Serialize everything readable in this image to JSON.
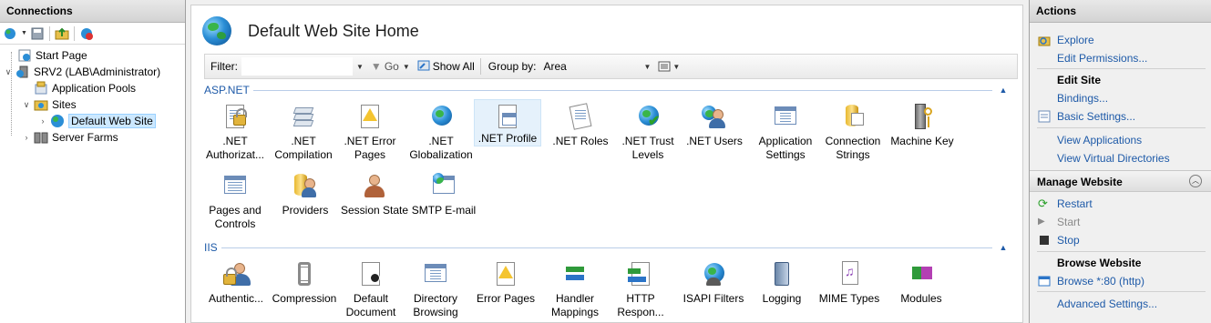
{
  "connections": {
    "title": "Connections",
    "tree": [
      {
        "label": "Start Page"
      },
      {
        "label": "SRV2 (LAB\\Administrator)"
      },
      {
        "label": "Application Pools"
      },
      {
        "label": "Sites"
      },
      {
        "label": "Default Web Site"
      },
      {
        "label": "Server Farms"
      }
    ]
  },
  "main": {
    "title": "Default Web Site Home",
    "filter_label": "Filter:",
    "filter_value": "",
    "go_label": "Go",
    "show_all_label": "Show All",
    "group_by_label": "Group by:",
    "group_by_value": "Area",
    "groups": [
      {
        "name": "ASP.NET",
        "features": [
          {
            "line1": ".NET",
            "line2": "Authorizat...",
            "icon": "lock-doc-icon"
          },
          {
            "line1": ".NET",
            "line2": "Compilation",
            "icon": "stack-icon"
          },
          {
            "line1": ".NET Error",
            "line2": "Pages",
            "icon": "warning-doc-icon"
          },
          {
            "line1": ".NET",
            "line2": "Globalization",
            "icon": "globe-icon"
          },
          {
            "line1": ".NET Profile",
            "line2": "",
            "icon": "profile-icon"
          },
          {
            "line1": ".NET Roles",
            "line2": "",
            "icon": "roles-icon"
          },
          {
            "line1": ".NET Trust",
            "line2": "Levels",
            "icon": "trust-icon"
          },
          {
            "line1": ".NET Users",
            "line2": "",
            "icon": "users-icon"
          },
          {
            "line1": "Application",
            "line2": "Settings",
            "icon": "settings-icon"
          },
          {
            "line1": "Connection",
            "line2": "Strings",
            "icon": "database-icon"
          },
          {
            "line1": "Machine Key",
            "line2": "",
            "icon": "machine-key-icon"
          },
          {
            "line1": "Pages and",
            "line2": "Controls",
            "icon": "pages-icon"
          },
          {
            "line1": "Providers",
            "line2": "",
            "icon": "providers-icon"
          },
          {
            "line1": "Session State",
            "line2": "",
            "icon": "session-icon"
          },
          {
            "line1": "SMTP E-mail",
            "line2": "",
            "icon": "smtp-icon"
          }
        ]
      },
      {
        "name": "IIS",
        "features": [
          {
            "line1": "Authentic...",
            "line2": "",
            "icon": "auth-icon"
          },
          {
            "line1": "Compression",
            "line2": "",
            "icon": "compression-icon"
          },
          {
            "line1": "Default",
            "line2": "Document",
            "icon": "default-doc-icon"
          },
          {
            "line1": "Directory",
            "line2": "Browsing",
            "icon": "dir-browse-icon"
          },
          {
            "line1": "Error Pages",
            "line2": "",
            "icon": "error-pages-icon"
          },
          {
            "line1": "Handler",
            "line2": "Mappings",
            "icon": "handler-icon"
          },
          {
            "line1": "HTTP",
            "line2": "Respon...",
            "icon": "http-response-icon"
          },
          {
            "line1": "ISAPI Filters",
            "line2": "",
            "icon": "isapi-icon"
          },
          {
            "line1": "Logging",
            "line2": "",
            "icon": "logging-icon"
          },
          {
            "line1": "MIME Types",
            "line2": "",
            "icon": "mime-icon"
          },
          {
            "line1": "Modules",
            "line2": "",
            "icon": "modules-icon"
          }
        ]
      }
    ]
  },
  "actions": {
    "title": "Actions",
    "explore": "Explore",
    "edit_permissions": "Edit Permissions...",
    "edit_site_header": "Edit Site",
    "bindings": "Bindings...",
    "basic_settings": "Basic Settings...",
    "view_applications": "View Applications",
    "view_virtual_directories": "View Virtual Directories",
    "manage_website_header": "Manage Website",
    "restart": "Restart",
    "start": "Start",
    "stop": "Stop",
    "browse_website_header": "Browse Website",
    "browse_80": "Browse *:80 (http)",
    "advanced_settings": "Advanced Settings..."
  },
  "colors": {
    "link": "#1e5aa8",
    "selection": "#cce8ff",
    "group_header": "#1e5aa8"
  }
}
